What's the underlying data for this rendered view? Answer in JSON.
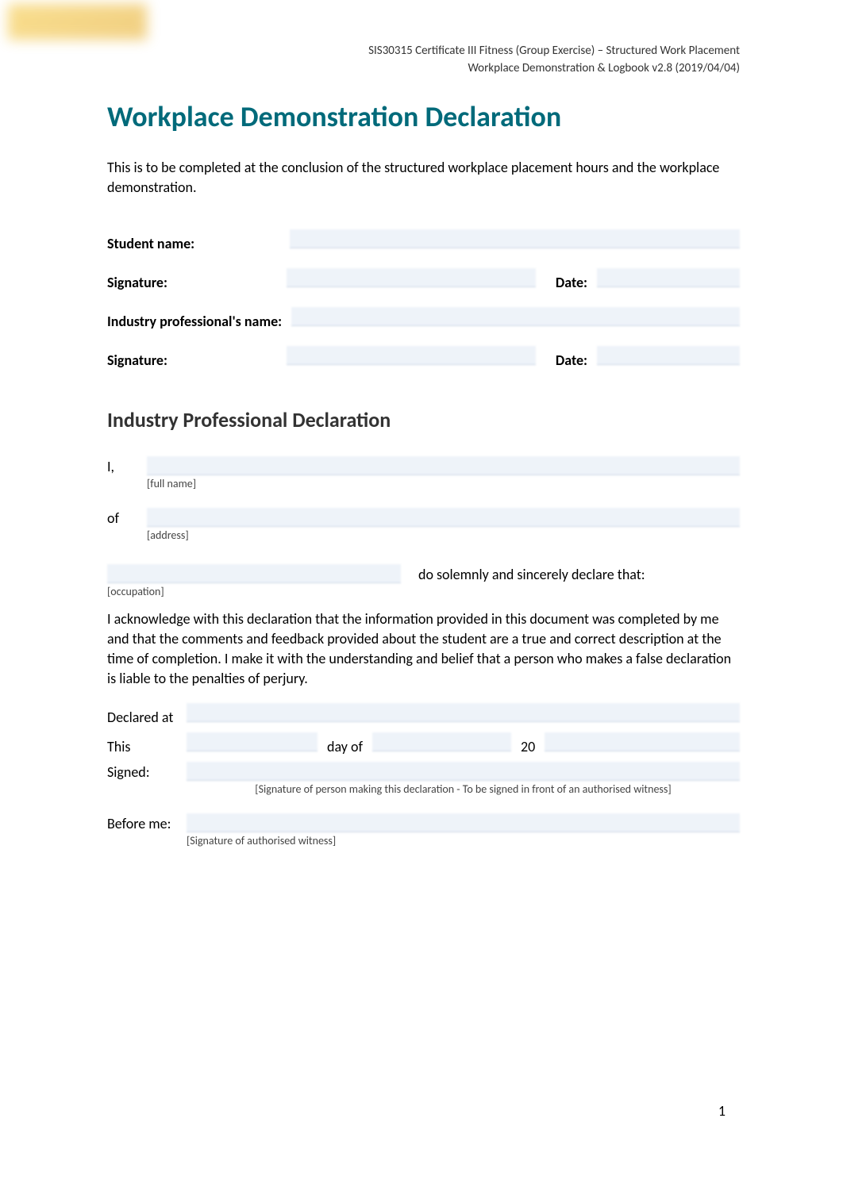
{
  "header": {
    "line1": "SIS30315 Certificate III Fitness (Group Exercise) – Structured Work Placement",
    "line2": "Workplace Demonstration & Logbook v2.8 (2019/04/04)"
  },
  "main_title": "Workplace Demonstration Declaration",
  "intro": "This is to be completed at the conclusion of the structured workplace placement hours and the workplace demonstration.",
  "form": {
    "student_name_label": "Student name:",
    "signature_label": "Signature:",
    "date_label": "Date:",
    "industry_name_label": "Industry professional's name:"
  },
  "sub_title": "Industry Professional Declaration",
  "declaration": {
    "i_label": "I,",
    "fullname_hint": "[full name]",
    "of_label": "of",
    "address_hint": "[address]",
    "occupation_hint": "[occupation]",
    "statement": "do solemnly and sincerely declare that:",
    "ack_text": "I acknowledge with this declaration that the information provided in this document was completed by me and that the comments and feedback provided about the student are a true and correct description at the time of completion. I make it with the understanding and belief that a person who makes a false declaration is liable to the penalties of perjury.",
    "declared_at_label": "Declared at",
    "this_label": "This",
    "dayof_label": "day of",
    "twenty_label": "20",
    "signed_label": "Signed:",
    "signed_hint": "[Signature of person making this declaration - To be signed in front of an authorised witness]",
    "before_label": "Before me:",
    "before_hint": "[Signature of authorised witness]"
  },
  "page_number": "1"
}
